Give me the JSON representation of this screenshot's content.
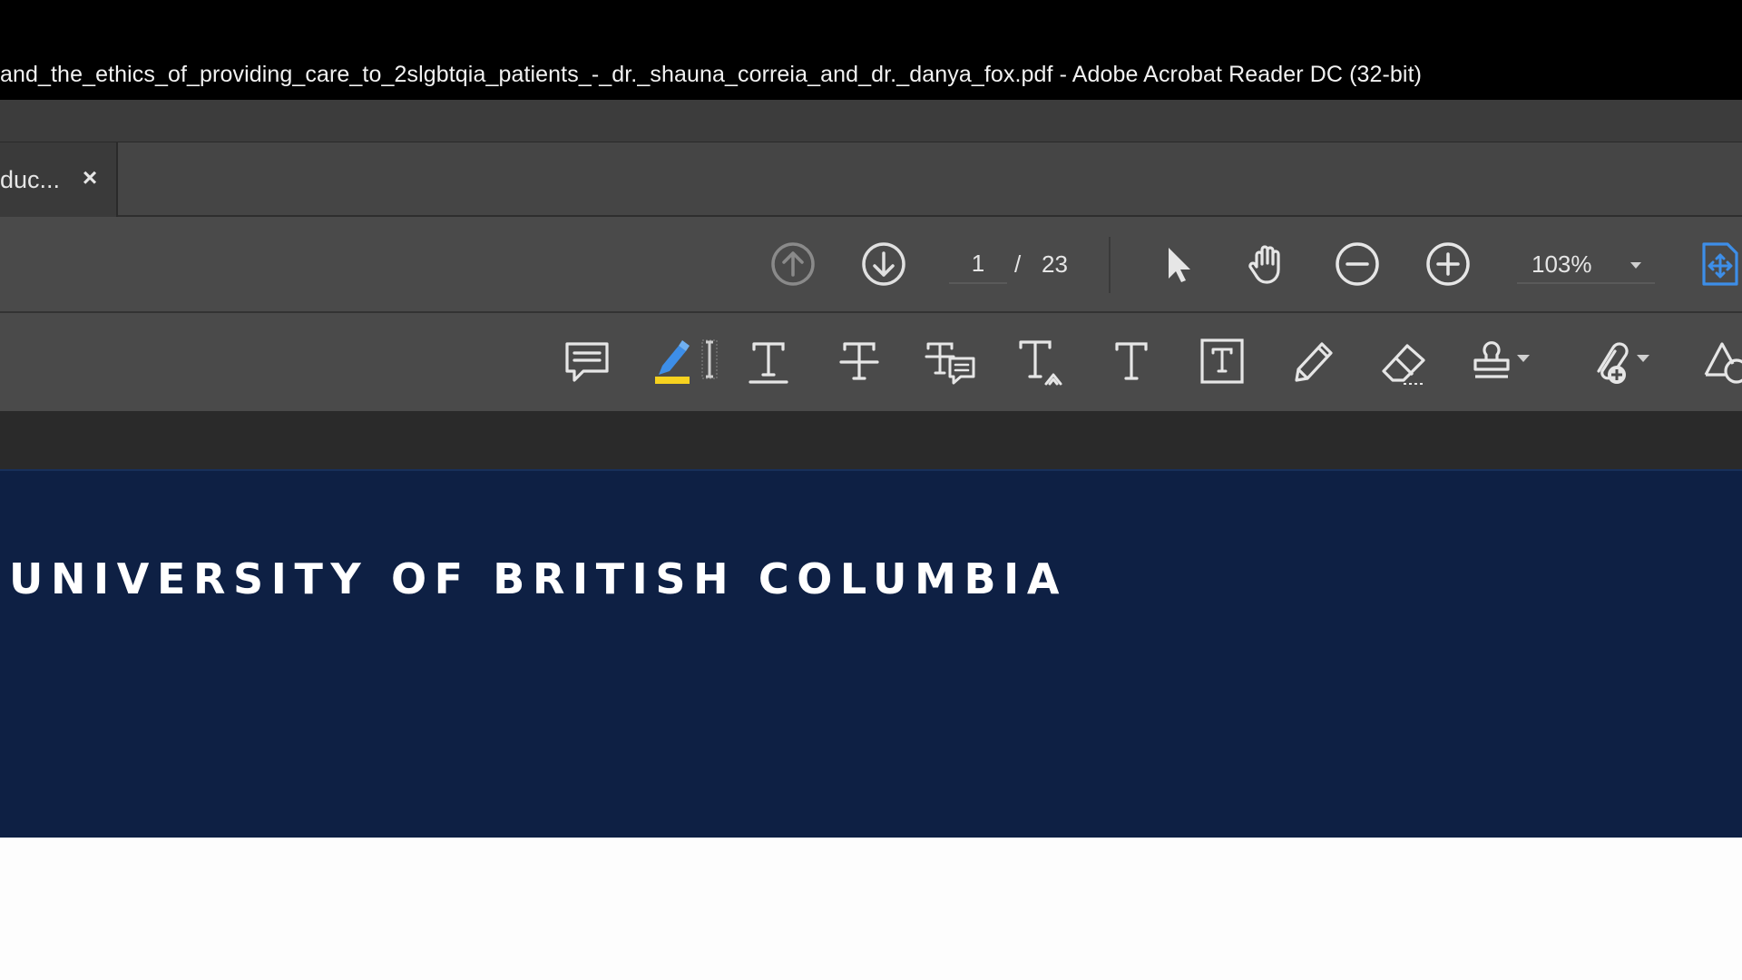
{
  "window": {
    "title": "and_the_ethics_of_providing_care_to_2slgbtqia_patients_-_dr._shauna_correia_and_dr._danya_fox.pdf - Adobe Acrobat Reader DC (32-bit)"
  },
  "tab": {
    "label": "duc...",
    "close": "×"
  },
  "nav": {
    "current_page": "1",
    "separator": "/",
    "total_pages": "23",
    "zoom": "103%"
  },
  "icons": {
    "prev_page": "arrow-up-circle-icon",
    "next_page": "arrow-down-circle-icon",
    "select": "cursor-icon",
    "hand": "hand-icon",
    "zoom_out": "minus-circle-icon",
    "zoom_in": "plus-circle-icon",
    "fit": "fit-page-icon",
    "comment": "comment-icon",
    "highlight": "highlighter-icon",
    "underline": "underline-text-icon",
    "strikethrough": "strikethrough-icon",
    "replace_text": "replace-text-icon",
    "insert_text": "insert-text-icon",
    "add_text": "add-text-icon",
    "text_box": "text-box-icon",
    "pencil": "pencil-icon",
    "eraser": "eraser-icon",
    "stamp": "stamp-icon",
    "attach": "attach-file-icon",
    "shapes": "shapes-icon"
  },
  "colors": {
    "accent_highlight": "#f7d21f",
    "accent_blue": "#3d8ee8",
    "banner_navy": "#0e2044"
  },
  "document": {
    "banner_text": "UNIVERSITY OF BRITISH COLUMBIA"
  }
}
